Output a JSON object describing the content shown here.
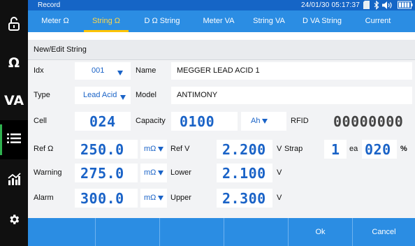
{
  "status": {
    "title": "Record",
    "datetime": "24/01/30  05:17:37"
  },
  "sidebar": {
    "items": [
      {
        "icon": "unlock-icon"
      },
      {
        "label": "Ω"
      },
      {
        "label": "VA"
      },
      {
        "icon": "list-icon",
        "active": true
      },
      {
        "icon": "chart-icon"
      },
      {
        "icon": "gear-icon"
      }
    ]
  },
  "tabs": [
    {
      "label": "Meter Ω"
    },
    {
      "label": "String Ω",
      "active": true
    },
    {
      "label": "D Ω String"
    },
    {
      "label": "Meter VA"
    },
    {
      "label": "String VA"
    },
    {
      "label": "D VA String"
    },
    {
      "label": "Current"
    }
  ],
  "form": {
    "title": "New/Edit String",
    "idx": {
      "label": "Idx",
      "value": "001"
    },
    "name": {
      "label": "Name",
      "value": "MEGGER LEAD ACID 1"
    },
    "type": {
      "label": "Type",
      "value": "Lead Acid"
    },
    "model": {
      "label": "Model",
      "value": "ANTIMONY"
    },
    "cell": {
      "label": "Cell",
      "value": "024"
    },
    "capacity": {
      "label": "Capacity",
      "value": "0100",
      "unit": "Ah"
    },
    "rfid": {
      "label": "RFID",
      "value": "00000000"
    },
    "ref_ohm": {
      "label": "Ref Ω",
      "value": "250.0",
      "unit": "mΩ"
    },
    "ref_v": {
      "label": "Ref V",
      "value": "2.200",
      "unit": "V"
    },
    "strap": {
      "label": "Strap",
      "value": "1",
      "unit": "ea",
      "pct": "020",
      "pct_unit": "%"
    },
    "warning": {
      "label": "Warning",
      "value": "275.0",
      "unit": "mΩ"
    },
    "lower": {
      "label": "Lower",
      "value": "2.100",
      "unit": "V"
    },
    "alarm": {
      "label": "Alarm",
      "value": "300.0",
      "unit": "mΩ"
    },
    "upper": {
      "label": "Upper",
      "value": "2.300",
      "unit": "V"
    }
  },
  "bottom": {
    "ok": "Ok",
    "cancel": "Cancel"
  },
  "colors": {
    "primary": "#2b8de3",
    "status": "#1565c6",
    "accent": "#ffc400",
    "value": "#1a63c7",
    "active_side": "#2fb04f"
  }
}
